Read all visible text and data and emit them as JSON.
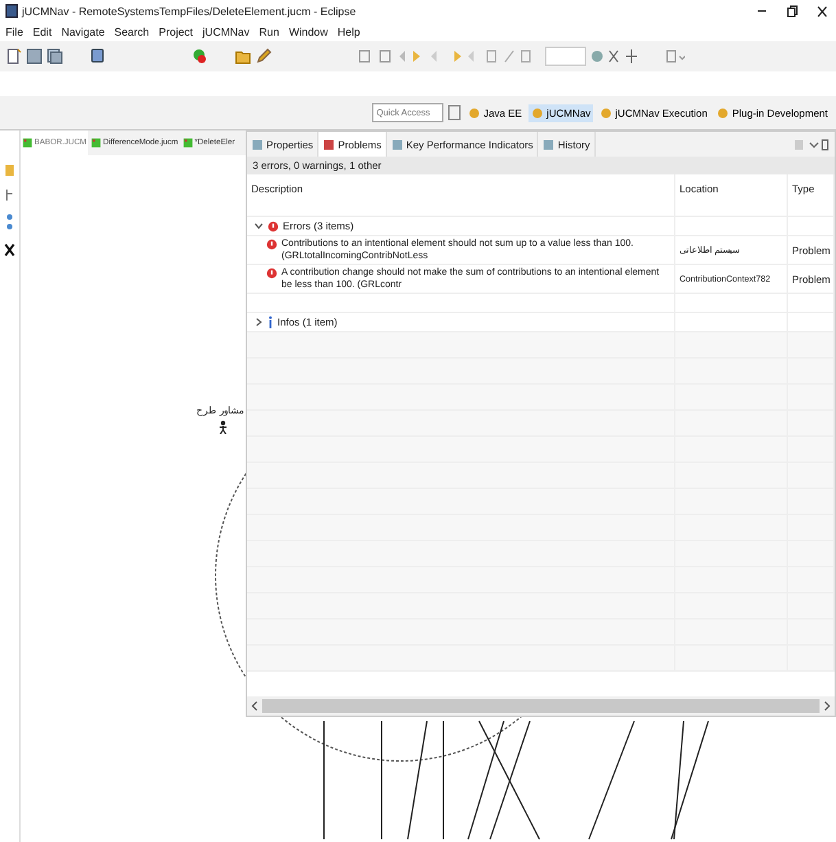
{
  "window": {
    "title": "jUCMNav - RemoteSystemsTempFiles/DeleteElement.jucm - Eclipse"
  },
  "menu": [
    "File",
    "Edit",
    "Navigate",
    "Search",
    "Project",
    "jUCMNav",
    "Run",
    "Window",
    "Help"
  ],
  "quick_access": {
    "placeholder": "Quick Access"
  },
  "perspectives": [
    {
      "label": "Java EE",
      "selected": false
    },
    {
      "label": "jUCMNav",
      "selected": true
    },
    {
      "label": "jUCMNav Execution",
      "selected": false
    },
    {
      "label": "Plug-in Development",
      "selected": false
    }
  ],
  "editor_tabs": [
    {
      "label": "BABOR.JUCM",
      "selected": true
    },
    {
      "label": "DifferenceMode.jucm",
      "selected": false
    },
    {
      "label": "*DeleteEler",
      "selected": false
    }
  ],
  "view_tabs": [
    {
      "label": "Properties",
      "selected": false
    },
    {
      "label": "Problems",
      "selected": true
    },
    {
      "label": "Key Performance Indicators",
      "selected": false
    },
    {
      "label": "History",
      "selected": false
    }
  ],
  "problems": {
    "summary": "3 errors, 0 warnings, 1 other",
    "columns": [
      "Description",
      "Location",
      "Type"
    ],
    "groups": [
      {
        "kind": "error",
        "label": "Errors (3 items)",
        "expanded": true,
        "children": [
          {
            "description": "Contributions to an intentional element should not sum up to a value less than 100.  (GRLtotalIncomingContribNotLess",
            "location": "سیستم اطلاعاتی",
            "type": "Problem"
          },
          {
            "description": "A contribution change should not make the sum of contributions to an intentional element be less than 100.  (GRLcontr",
            "location": "ContributionContext782",
            "type": "Problem"
          }
        ]
      },
      {
        "kind": "info",
        "label": "Infos (1 item)",
        "expanded": false
      }
    ]
  },
  "diagram": {
    "label": "مشاور طرح"
  }
}
